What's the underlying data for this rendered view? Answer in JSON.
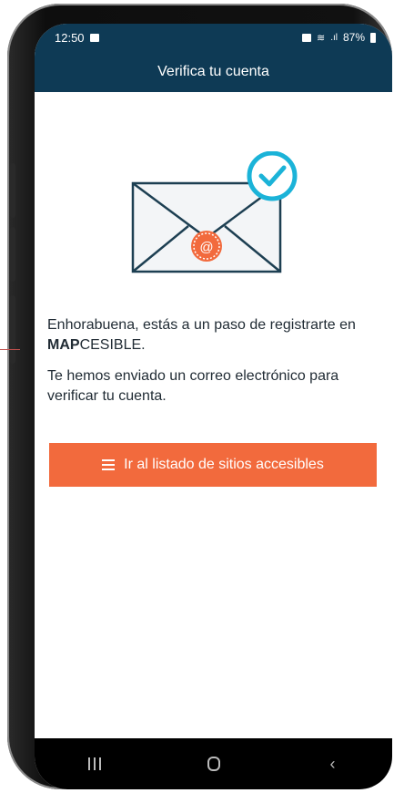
{
  "status": {
    "time": "12:50",
    "battery": "87%"
  },
  "appbar": {
    "title": "Verifica tu cuenta"
  },
  "illustration": {
    "at_symbol": "@",
    "icons": [
      "envelope-icon",
      "check-circle-icon",
      "at-seal-icon"
    ]
  },
  "message": {
    "line1_prefix": "Enhorabuena, estás a un paso de registrarte en ",
    "brand_bold": "MAP",
    "brand_rest": "CESIBLE.",
    "line2": "Te hemos enviado un correo electrónico para verificar tu cuenta."
  },
  "cta": {
    "label": "Ir al listado de sitios accesibles"
  },
  "navbar": {
    "back_glyph": "‹"
  },
  "colors": {
    "header": "#0e3a55",
    "accent": "#f26a3d",
    "check": "#1bb3d8"
  }
}
